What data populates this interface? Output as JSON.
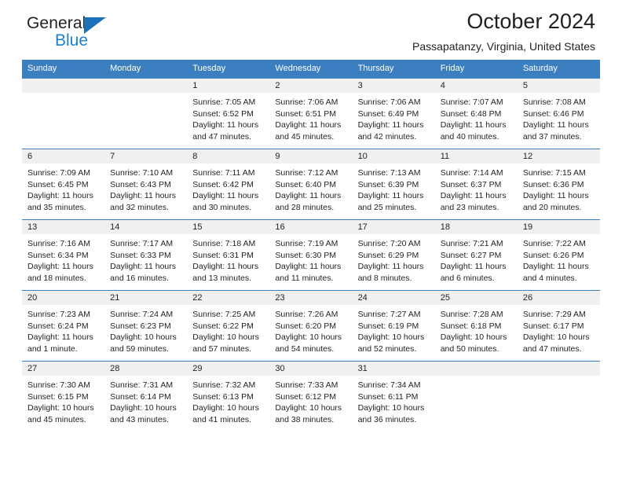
{
  "brand": {
    "name_top": "General",
    "name_bottom": "Blue",
    "triangle_color": "#1c72b8",
    "blue_color": "#1c7fd4"
  },
  "header": {
    "title": "October 2024",
    "subtitle": "Passapatanzy, Virginia, United States"
  },
  "theme": {
    "header_blue": "#3c7fc1",
    "daynum_band": "#f0f0f0",
    "text": "#231f20"
  },
  "calendar": {
    "weekday_headers": [
      "Sunday",
      "Monday",
      "Tuesday",
      "Wednesday",
      "Thursday",
      "Friday",
      "Saturday"
    ],
    "weeks": [
      [
        {
          "day": "",
          "sunrise": "",
          "sunset": "",
          "daylight": ""
        },
        {
          "day": "",
          "sunrise": "",
          "sunset": "",
          "daylight": ""
        },
        {
          "day": "1",
          "sunrise": "Sunrise: 7:05 AM",
          "sunset": "Sunset: 6:52 PM",
          "daylight": "Daylight: 11 hours and 47 minutes."
        },
        {
          "day": "2",
          "sunrise": "Sunrise: 7:06 AM",
          "sunset": "Sunset: 6:51 PM",
          "daylight": "Daylight: 11 hours and 45 minutes."
        },
        {
          "day": "3",
          "sunrise": "Sunrise: 7:06 AM",
          "sunset": "Sunset: 6:49 PM",
          "daylight": "Daylight: 11 hours and 42 minutes."
        },
        {
          "day": "4",
          "sunrise": "Sunrise: 7:07 AM",
          "sunset": "Sunset: 6:48 PM",
          "daylight": "Daylight: 11 hours and 40 minutes."
        },
        {
          "day": "5",
          "sunrise": "Sunrise: 7:08 AM",
          "sunset": "Sunset: 6:46 PM",
          "daylight": "Daylight: 11 hours and 37 minutes."
        }
      ],
      [
        {
          "day": "6",
          "sunrise": "Sunrise: 7:09 AM",
          "sunset": "Sunset: 6:45 PM",
          "daylight": "Daylight: 11 hours and 35 minutes."
        },
        {
          "day": "7",
          "sunrise": "Sunrise: 7:10 AM",
          "sunset": "Sunset: 6:43 PM",
          "daylight": "Daylight: 11 hours and 32 minutes."
        },
        {
          "day": "8",
          "sunrise": "Sunrise: 7:11 AM",
          "sunset": "Sunset: 6:42 PM",
          "daylight": "Daylight: 11 hours and 30 minutes."
        },
        {
          "day": "9",
          "sunrise": "Sunrise: 7:12 AM",
          "sunset": "Sunset: 6:40 PM",
          "daylight": "Daylight: 11 hours and 28 minutes."
        },
        {
          "day": "10",
          "sunrise": "Sunrise: 7:13 AM",
          "sunset": "Sunset: 6:39 PM",
          "daylight": "Daylight: 11 hours and 25 minutes."
        },
        {
          "day": "11",
          "sunrise": "Sunrise: 7:14 AM",
          "sunset": "Sunset: 6:37 PM",
          "daylight": "Daylight: 11 hours and 23 minutes."
        },
        {
          "day": "12",
          "sunrise": "Sunrise: 7:15 AM",
          "sunset": "Sunset: 6:36 PM",
          "daylight": "Daylight: 11 hours and 20 minutes."
        }
      ],
      [
        {
          "day": "13",
          "sunrise": "Sunrise: 7:16 AM",
          "sunset": "Sunset: 6:34 PM",
          "daylight": "Daylight: 11 hours and 18 minutes."
        },
        {
          "day": "14",
          "sunrise": "Sunrise: 7:17 AM",
          "sunset": "Sunset: 6:33 PM",
          "daylight": "Daylight: 11 hours and 16 minutes."
        },
        {
          "day": "15",
          "sunrise": "Sunrise: 7:18 AM",
          "sunset": "Sunset: 6:31 PM",
          "daylight": "Daylight: 11 hours and 13 minutes."
        },
        {
          "day": "16",
          "sunrise": "Sunrise: 7:19 AM",
          "sunset": "Sunset: 6:30 PM",
          "daylight": "Daylight: 11 hours and 11 minutes."
        },
        {
          "day": "17",
          "sunrise": "Sunrise: 7:20 AM",
          "sunset": "Sunset: 6:29 PM",
          "daylight": "Daylight: 11 hours and 8 minutes."
        },
        {
          "day": "18",
          "sunrise": "Sunrise: 7:21 AM",
          "sunset": "Sunset: 6:27 PM",
          "daylight": "Daylight: 11 hours and 6 minutes."
        },
        {
          "day": "19",
          "sunrise": "Sunrise: 7:22 AM",
          "sunset": "Sunset: 6:26 PM",
          "daylight": "Daylight: 11 hours and 4 minutes."
        }
      ],
      [
        {
          "day": "20",
          "sunrise": "Sunrise: 7:23 AM",
          "sunset": "Sunset: 6:24 PM",
          "daylight": "Daylight: 11 hours and 1 minute."
        },
        {
          "day": "21",
          "sunrise": "Sunrise: 7:24 AM",
          "sunset": "Sunset: 6:23 PM",
          "daylight": "Daylight: 10 hours and 59 minutes."
        },
        {
          "day": "22",
          "sunrise": "Sunrise: 7:25 AM",
          "sunset": "Sunset: 6:22 PM",
          "daylight": "Daylight: 10 hours and 57 minutes."
        },
        {
          "day": "23",
          "sunrise": "Sunrise: 7:26 AM",
          "sunset": "Sunset: 6:20 PM",
          "daylight": "Daylight: 10 hours and 54 minutes."
        },
        {
          "day": "24",
          "sunrise": "Sunrise: 7:27 AM",
          "sunset": "Sunset: 6:19 PM",
          "daylight": "Daylight: 10 hours and 52 minutes."
        },
        {
          "day": "25",
          "sunrise": "Sunrise: 7:28 AM",
          "sunset": "Sunset: 6:18 PM",
          "daylight": "Daylight: 10 hours and 50 minutes."
        },
        {
          "day": "26",
          "sunrise": "Sunrise: 7:29 AM",
          "sunset": "Sunset: 6:17 PM",
          "daylight": "Daylight: 10 hours and 47 minutes."
        }
      ],
      [
        {
          "day": "27",
          "sunrise": "Sunrise: 7:30 AM",
          "sunset": "Sunset: 6:15 PM",
          "daylight": "Daylight: 10 hours and 45 minutes."
        },
        {
          "day": "28",
          "sunrise": "Sunrise: 7:31 AM",
          "sunset": "Sunset: 6:14 PM",
          "daylight": "Daylight: 10 hours and 43 minutes."
        },
        {
          "day": "29",
          "sunrise": "Sunrise: 7:32 AM",
          "sunset": "Sunset: 6:13 PM",
          "daylight": "Daylight: 10 hours and 41 minutes."
        },
        {
          "day": "30",
          "sunrise": "Sunrise: 7:33 AM",
          "sunset": "Sunset: 6:12 PM",
          "daylight": "Daylight: 10 hours and 38 minutes."
        },
        {
          "day": "31",
          "sunrise": "Sunrise: 7:34 AM",
          "sunset": "Sunset: 6:11 PM",
          "daylight": "Daylight: 10 hours and 36 minutes."
        },
        {
          "day": "",
          "sunrise": "",
          "sunset": "",
          "daylight": ""
        },
        {
          "day": "",
          "sunrise": "",
          "sunset": "",
          "daylight": ""
        }
      ]
    ]
  }
}
